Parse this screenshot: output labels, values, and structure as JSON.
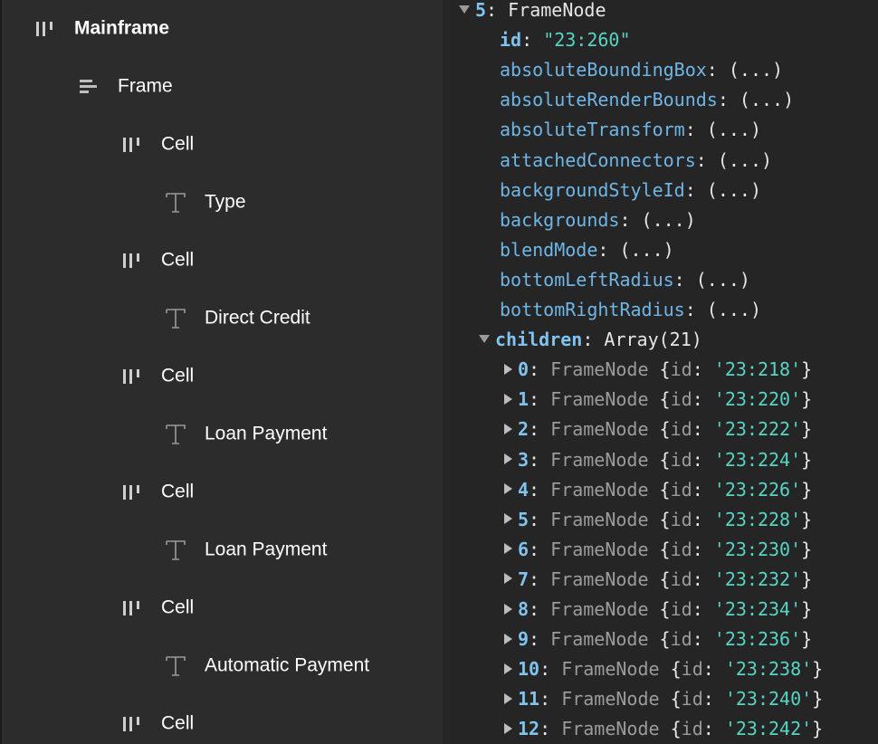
{
  "layers": [
    {
      "icon": "frame-icon",
      "label": "Mainframe",
      "bold": true
    },
    {
      "icon": "auto-layout-icon",
      "label": "Frame",
      "bold": false
    },
    {
      "icon": "frame-icon",
      "label": "Cell",
      "bold": false
    },
    {
      "icon": "text-icon",
      "label": "Type",
      "bold": false
    },
    {
      "icon": "frame-icon",
      "label": "Cell",
      "bold": false
    },
    {
      "icon": "text-icon",
      "label": "Direct Credit",
      "bold": false
    },
    {
      "icon": "frame-icon",
      "label": "Cell",
      "bold": false
    },
    {
      "icon": "text-icon",
      "label": "Loan Payment",
      "bold": false
    },
    {
      "icon": "frame-icon",
      "label": "Cell",
      "bold": false
    },
    {
      "icon": "text-icon",
      "label": "Loan Payment",
      "bold": false
    },
    {
      "icon": "frame-icon",
      "label": "Cell",
      "bold": false
    },
    {
      "icon": "text-icon",
      "label": "Automatic Payment",
      "bold": false
    },
    {
      "icon": "frame-icon",
      "label": "Cell",
      "bold": false
    }
  ],
  "console": {
    "header": {
      "index": "5",
      "type": "FrameNode"
    },
    "id": {
      "key": "id",
      "value": "\"23:260\""
    },
    "props": [
      "absoluteBoundingBox",
      "absoluteRenderBounds",
      "absoluteTransform",
      "attachedConnectors",
      "backgroundStyleId",
      "backgrounds",
      "blendMode",
      "bottomLeftRadius",
      "bottomRightRadius"
    ],
    "collapsed_value": "(...)",
    "children": {
      "key": "children",
      "value": "Array(21)"
    },
    "child_items": [
      {
        "index": "0",
        "type": "FrameNode",
        "id": "'23:218'"
      },
      {
        "index": "1",
        "type": "FrameNode",
        "id": "'23:220'"
      },
      {
        "index": "2",
        "type": "FrameNode",
        "id": "'23:222'"
      },
      {
        "index": "3",
        "type": "FrameNode",
        "id": "'23:224'"
      },
      {
        "index": "4",
        "type": "FrameNode",
        "id": "'23:226'"
      },
      {
        "index": "5",
        "type": "FrameNode",
        "id": "'23:228'"
      },
      {
        "index": "6",
        "type": "FrameNode",
        "id": "'23:230'"
      },
      {
        "index": "7",
        "type": "FrameNode",
        "id": "'23:232'"
      },
      {
        "index": "8",
        "type": "FrameNode",
        "id": "'23:234'"
      },
      {
        "index": "9",
        "type": "FrameNode",
        "id": "'23:236'"
      },
      {
        "index": "10",
        "type": "FrameNode",
        "id": "'23:238'"
      },
      {
        "index": "11",
        "type": "FrameNode",
        "id": "'23:240'"
      },
      {
        "index": "12",
        "type": "FrameNode",
        "id": "'23:242'"
      }
    ]
  },
  "colors": {
    "panel_bg": "#2c2c2c",
    "console_bg": "#252525",
    "key": "#6fb6e6",
    "string": "#56d4c4"
  }
}
